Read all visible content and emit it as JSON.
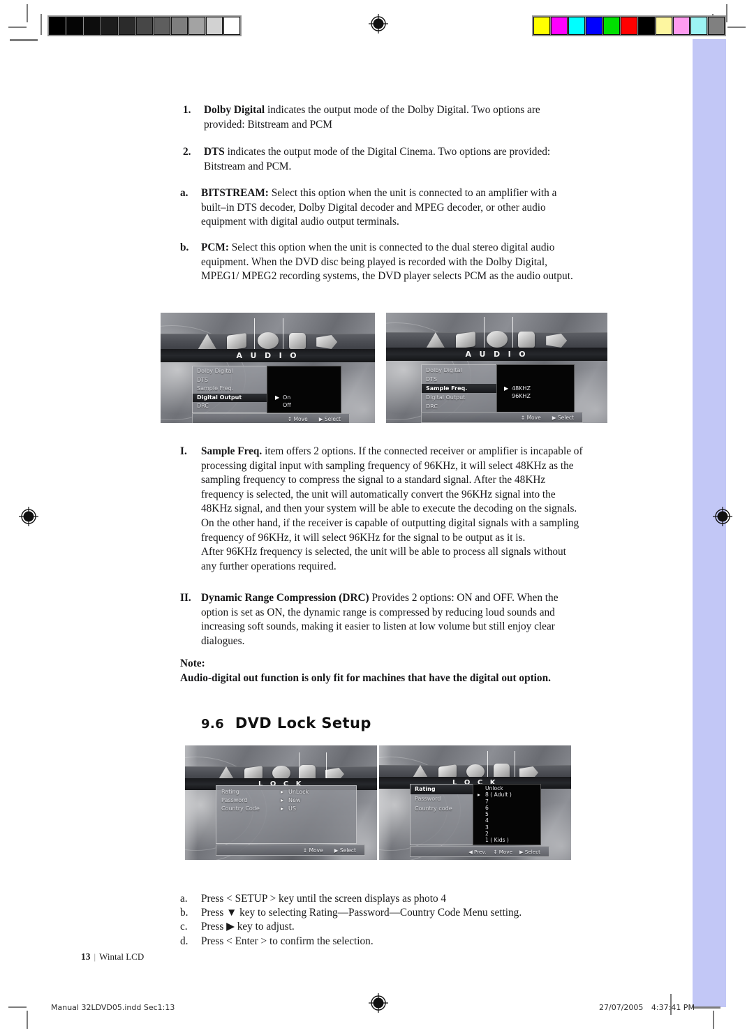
{
  "print_marks": {
    "gray_wedge_swatches": [
      "#000000",
      "#050505",
      "#0d0d0d",
      "#1c1c1c",
      "#2b2b2b",
      "#474747",
      "#5e5e5e",
      "#7e7e7e",
      "#a3a3a3",
      "#d2d2d2",
      "#ffffff"
    ],
    "color_bar_swatches": [
      "#ffff00",
      "#ff00ff",
      "#00ffff",
      "#0000ff",
      "#00e000",
      "#ff0000",
      "#000000",
      "#fdf6a0",
      "#ff9cf0",
      "#9cf3f3",
      "#808080"
    ],
    "registration_icon": "registration-target-icon",
    "edge_band_color": "#c2c7f6"
  },
  "body": {
    "items": [
      {
        "marker": "1.",
        "lead": "Dolby Digital",
        "text": " indicates the output mode of the Dolby Digital. Two options are provided: Bitstream and PCM"
      },
      {
        "marker": "2.",
        "lead": "DTS",
        "text": " indicates the output mode of the Digital Cinema. Two options are provided: Bitstream and PCM."
      },
      {
        "marker": "a.",
        "lead": "BITSTREAM:",
        "text": " Select this option when the unit is connected to an amplifier with a built–in DTS decoder, Dolby Digital decoder and MPEG decoder, or other audio equipment with digital audio output terminals."
      },
      {
        "marker": "b.",
        "lead": "PCM:",
        "text": " Select this option when the unit is connected to the dual stereo digital audio equipment. When the DVD disc being played is recorded with the Dolby Digital, MPEG1/ MPEG2 recording systems, the DVD player selects PCM as the audio output."
      },
      {
        "marker": "I.",
        "lead": "Sample Freq.",
        "text": " item offers 2 options. If the connected receiver or amplifier is incapable of processing digital input with sampling frequency of 96KHz, it will select 48KHz as the sampling frequency to compress the signal to a standard signal. After the 48KHz frequency is selected, the unit will automatically convert the 96KHz signal into the 48KHz signal, and then your system will be able to execute the decoding on the signals. On the other hand, if the receiver is capable of outputting digital signals with a sampling frequency of 96KHz, it will select 96KHz for the signal to be output as it is.",
        "text2": "After 96KHz frequency is selected, the unit will   be able to process all signals without any further operations required."
      },
      {
        "marker": "II.",
        "lead": "Dynamic Range Compression (DRC)",
        "text": " Provides 2 options: ON and OFF. When the option is set as ON, the dynamic range is compressed by reducing loud sounds and increasing soft sounds, making it easier to listen at low volume but still enjoy clear dialogues."
      }
    ],
    "note_label": "Note:",
    "note_text": "Audio-digital out function is only fit for machines that have the digital out option."
  },
  "section": {
    "number": "9.6",
    "title": "DVD Lock Setup"
  },
  "steps": [
    {
      "label": "a.",
      "text": "Press < SETUP > key until the screen displays as photo 4"
    },
    {
      "label": "b.",
      "text": "Press ▼ key to selecting Rating—Password—Country Code Menu setting."
    },
    {
      "label": "c.",
      "text": "Press ▶ key to adjust."
    },
    {
      "label": "d.",
      "text": "Press < Enter > to confirm the selection."
    }
  ],
  "screenshots": {
    "audio_digital_output": {
      "title": "A U D I O",
      "menu": [
        "Dolby Digital",
        "DTS",
        "Sample Freq.",
        "Digital Output",
        "DRC"
      ],
      "selected_menu_index": 3,
      "options": [
        "On",
        "Off"
      ],
      "selected_option_index": 0,
      "hints": [
        "↕ Move",
        "▶ Select"
      ]
    },
    "audio_sample_freq": {
      "title": "A U D I O",
      "menu": [
        "Dolby Digital",
        "DTS",
        "Sample Freq.",
        "Digital Output",
        "DRC"
      ],
      "selected_menu_index": 2,
      "options": [
        "48KHZ",
        "96KHZ"
      ],
      "selected_option_index": 0,
      "hints": [
        "↕ Move",
        "▶ Select"
      ]
    },
    "lock_overview": {
      "title": "L O C K",
      "menu": [
        "Rating",
        "Password",
        "Country Code"
      ],
      "values": [
        "UnLock",
        "New",
        "US"
      ],
      "hints": [
        "↕ Move",
        "▶ Select"
      ]
    },
    "lock_rating": {
      "title": "L O C K",
      "menu": [
        "Rating",
        "Password",
        "Country code"
      ],
      "selected_menu_index": 0,
      "options": [
        "Unlock",
        "8 ( Adult )",
        "7",
        "6",
        "5",
        "4",
        "3",
        "2",
        "1 ( Kids )"
      ],
      "selected_option_index": 1,
      "hints": [
        "◀ Prev.",
        "↕ Move",
        "▶ Select"
      ]
    }
  },
  "footer": {
    "page_number": "13",
    "separator": "|",
    "product": "Wintal LCD"
  },
  "slug": {
    "file": "Manual 32LDVD05.indd   Sec1:13",
    "date": "27/07/2005",
    "time": "4:37:41 PM"
  }
}
